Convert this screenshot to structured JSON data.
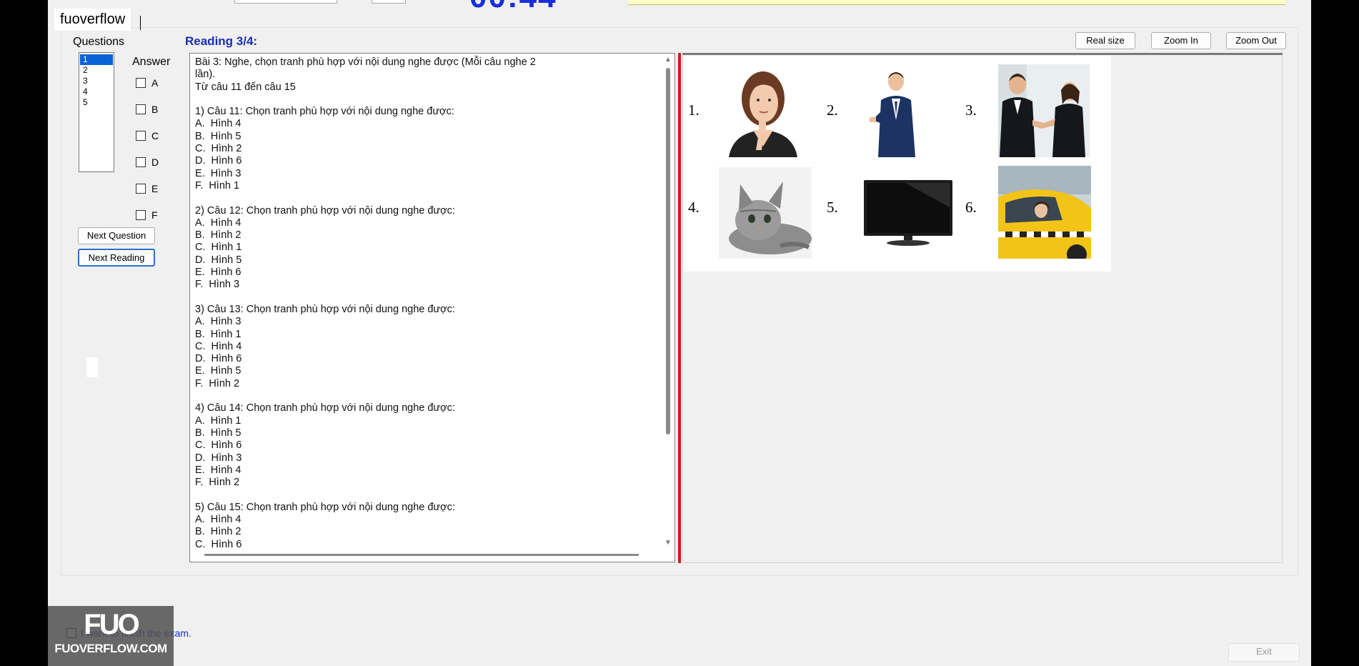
{
  "watermark": "fuoverflow",
  "timer_partial": "00:44",
  "reading": {
    "title": "Reading 3/4:"
  },
  "questions": {
    "label": "Questions",
    "items": [
      "1",
      "2",
      "3",
      "4",
      "5"
    ],
    "selected": "1"
  },
  "answer": {
    "label": "Answer",
    "options": [
      "A",
      "B",
      "C",
      "D",
      "E",
      "F"
    ]
  },
  "buttons": {
    "next_question": "Next Question",
    "next_reading": "Next Reading",
    "real_size": "Real size",
    "zoom_in": "Zoom In",
    "zoom_out": "Zoom Out",
    "exit": "Exit"
  },
  "reading_text": "Bài 3: Nghe, chọn tranh phù hợp với nội dung nghe được (Mỗi câu nghe 2\nlần).\nTừ câu 11 đến câu 15\n\n1) Câu 11: Chọn tranh phù hợp với nội dung nghe được:\nA.  Hình 4\nB.  Hình 5\nC.  Hình 2\nD.  Hình 6\nE.  Hình 3\nF.  Hình 1\n\n2) Câu 12: Chọn tranh phù hợp với nội dung nghe được:\nA.  Hình 4\nB.  Hình 2\nC.  Hình 1\nD.  Hình 5\nE.  Hình 6\nF.  Hình 3\n\n3) Câu 13: Chọn tranh phù hợp với nội dung nghe được:\nA.  Hình 3\nB.  Hình 1\nC.  Hình 4\nD.  Hình 6\nE.  Hình 5\nF.  Hình 2\n\n4) Câu 14: Chọn tranh phù hợp với nội dung nghe được:\nA.  Hình 1\nB.  Hình 5\nC.  Hình 6\nD.  Hình 3\nE.  Hình 4\nF.  Hình 2\n\n5) Câu 15: Chọn tranh phù hợp với nội dung nghe được:\nA.  Hình 4\nB.  Hình 2\nC.  Hình 6",
  "image_labels": [
    "1.",
    "2.",
    "3.",
    "4.",
    "5.",
    "6."
  ],
  "finish_text": "I want to finish the exam.",
  "logo": {
    "mark": "FUO",
    "text": "FUOVERFLOW.COM"
  },
  "colors": {
    "accent_blue": "#1a2eb4",
    "divider_red": "#d51a1a",
    "select_blue": "#0a62d6"
  }
}
